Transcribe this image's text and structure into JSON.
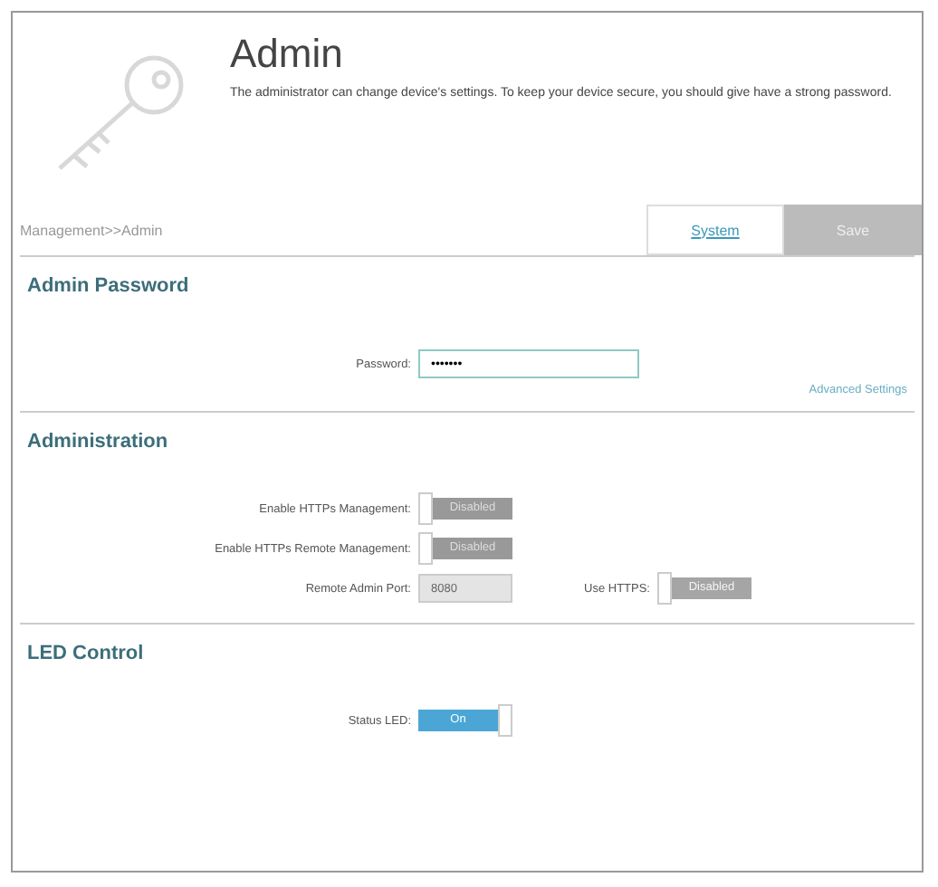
{
  "header": {
    "title": "Admin",
    "description": "The administrator can change device's settings. To keep your device secure, you should give have a strong password."
  },
  "breadcrumb": "Management>>Admin",
  "buttons": [
    {
      "label": "System",
      "kind": "link"
    },
    {
      "label": "Save",
      "kind": "disabled"
    }
  ],
  "admin_password": {
    "title": "Admin Password",
    "field": {
      "label": "Password:",
      "value": "•••••••"
    },
    "link": "Advanced Settings"
  },
  "administration": {
    "title": "Administration",
    "rows": [
      {
        "kind": "toggle",
        "label": "Enable HTTPs Management:",
        "toggle": {
          "text": "Disabled",
          "on": false,
          "disabled": false
        }
      },
      {
        "kind": "toggle",
        "label": "Enable HTTPs Remote Management:",
        "toggle": {
          "text": "Disabled",
          "on": false,
          "disabled": false
        }
      },
      {
        "kind": "port",
        "label": "Remote Admin Port:",
        "value": "8080",
        "extra_label": "Use HTTPS:",
        "toggle": {
          "text": "Disabled",
          "on": false,
          "disabled": true
        }
      }
    ]
  },
  "led_control": {
    "title": "LED Control",
    "rows": [
      {
        "kind": "toggle",
        "label": "Status LED:",
        "toggle": {
          "text": "On",
          "on": true,
          "disabled": false
        }
      }
    ]
  }
}
